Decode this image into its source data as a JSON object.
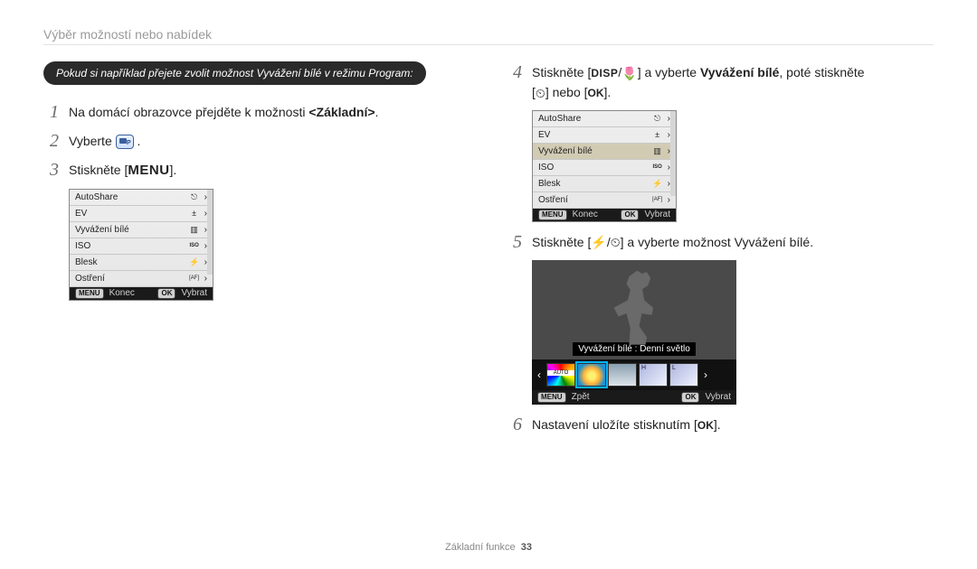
{
  "header": {
    "title": "Výběr možností nebo nabídek"
  },
  "pill": "Pokud si například přejete zvolit možnost Vyvážení bílé v režimu Program:",
  "steps": {
    "s1_pre": "Na domácí obrazovce přejděte k možnosti ",
    "s1_bold": "<Základní>",
    "s1_post": ".",
    "s2": "Vyberte ",
    "s3_pre": "Stiskněte [",
    "s3_menu": "MENU",
    "s3_post": "].",
    "s4_pre": "Stiskněte [",
    "s4_disp": "DISP",
    "s4_mid1": "/",
    "s4_mid2": "] a vyberte ",
    "s4_bold": "Vyvážení bílé",
    "s4_mid3": ", poté stiskněte",
    "s4_line2_pre": "[",
    "s4_line2_mid": "] nebo [",
    "s4_ok": "OK",
    "s4_line2_post": "].",
    "s5_pre": "Stiskněte [",
    "s5_mid": "/",
    "s5_post": "] a vyberte možnost Vyvážení bílé.",
    "s6_pre": "Nastavení uložíte stisknutím [",
    "s6_ok": "OK",
    "s6_post": "]."
  },
  "panel": {
    "rows": [
      {
        "label": "AutoShare",
        "icon": "⎋"
      },
      {
        "label": "EV",
        "icon": "±"
      },
      {
        "label": "Vyvážení bílé",
        "icon": "▥"
      },
      {
        "label": "ISO",
        "icon": "ISO"
      },
      {
        "label": "Blesk",
        "icon": "⚡"
      },
      {
        "label": "Ostření",
        "icon": "[AF]"
      }
    ],
    "footer_left_glyph": "MENU",
    "footer_left": "Konec",
    "footer_right_glyph": "OK",
    "footer_right": "Vybrat"
  },
  "panel2_highlight_index": 2,
  "wb": {
    "caption": "Vyvážení bílé : Denní světlo",
    "footer_left_glyph": "MENU",
    "footer_left": "Zpět",
    "footer_right_glyph": "OK",
    "footer_right": "Vybrat"
  },
  "footer": {
    "section": "Základní funkce",
    "page": "33"
  }
}
